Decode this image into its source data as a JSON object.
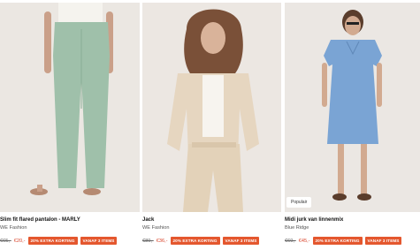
{
  "products": [
    {
      "name": "Slim fit flared pantalon - MARLY",
      "brand": "WE Fashion",
      "old_price": "€65,-",
      "new_price": "€20,-",
      "badges": [
        "20% EXTRA KORTING",
        "VANAF 3 ITEMS"
      ],
      "label": ""
    },
    {
      "name": "Jack",
      "brand": "WE Fashion",
      "old_price": "€89,-",
      "new_price": "€36,-",
      "badges": [
        "20% EXTRA KORTING",
        "VANAF 3 ITEMS"
      ],
      "label": ""
    },
    {
      "name": "Midi jurk van linnenmix",
      "brand": "Blue Ridge",
      "old_price": "€69,-",
      "new_price": "€45,-",
      "badges": [
        "20% EXTRA KORTING",
        "VANAF 3 ITEMS"
      ],
      "label": "Populair"
    }
  ],
  "colors": {
    "badge_bg": "#e4572e",
    "sale_price": "#d9452c",
    "image_bg": "#ebe6e1"
  }
}
